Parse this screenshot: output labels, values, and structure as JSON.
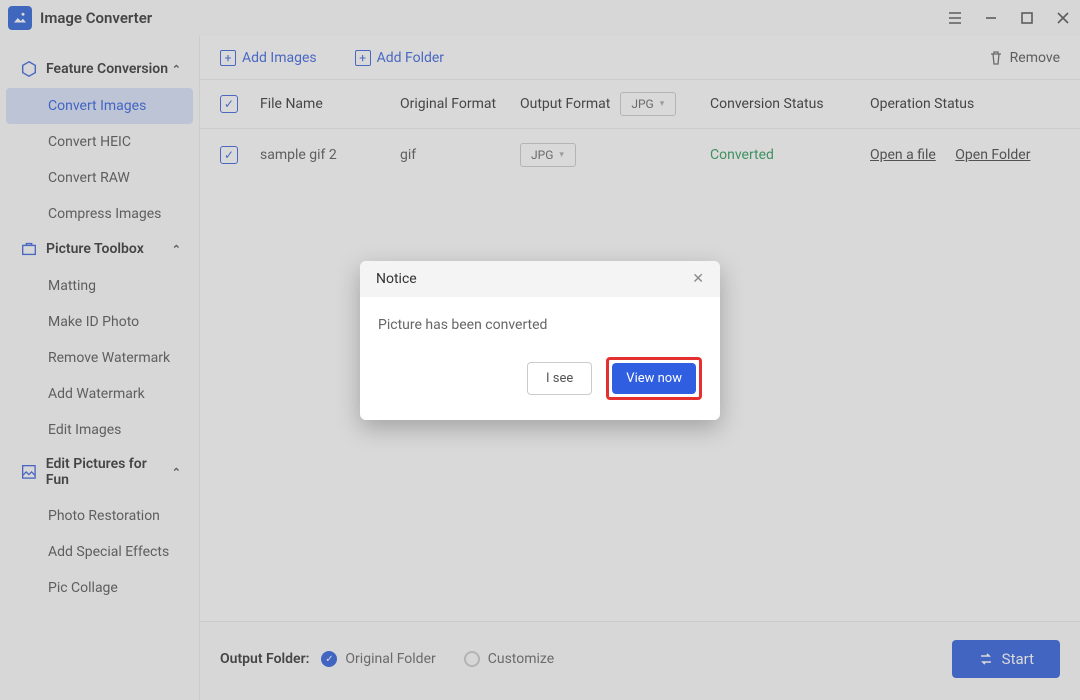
{
  "app": {
    "title": "Image Converter"
  },
  "sidebar": {
    "sections": [
      {
        "label": "Feature Conversion",
        "items": [
          {
            "label": "Convert Images",
            "active": true
          },
          {
            "label": "Convert HEIC"
          },
          {
            "label": "Convert RAW"
          },
          {
            "label": "Compress Images"
          }
        ]
      },
      {
        "label": "Picture Toolbox",
        "items": [
          {
            "label": "Matting"
          },
          {
            "label": "Make ID Photo"
          },
          {
            "label": "Remove Watermark"
          },
          {
            "label": "Add Watermark"
          },
          {
            "label": "Edit Images"
          }
        ]
      },
      {
        "label": "Edit Pictures for Fun",
        "items": [
          {
            "label": "Photo Restoration"
          },
          {
            "label": "Add Special Effects"
          },
          {
            "label": "Pic Collage"
          }
        ]
      }
    ]
  },
  "toolbar": {
    "add_images": "Add Images",
    "add_folder": "Add Folder",
    "remove": "Remove"
  },
  "table": {
    "headers": {
      "file_name": "File Name",
      "original_format": "Original Format",
      "output_format": "Output Format",
      "output_format_value": "JPG",
      "conversion_status": "Conversion Status",
      "operation_status": "Operation Status"
    },
    "rows": [
      {
        "file_name": "sample gif 2",
        "original_format": "gif",
        "output_format": "JPG",
        "conversion_status": "Converted",
        "op_open_file": "Open a file",
        "op_open_folder": "Open Folder"
      }
    ]
  },
  "footer": {
    "label": "Output Folder:",
    "option_original": "Original Folder",
    "option_customize": "Customize",
    "start": "Start"
  },
  "modal": {
    "title": "Notice",
    "message": "Picture has been converted",
    "cancel": "I see",
    "confirm": "View now"
  }
}
